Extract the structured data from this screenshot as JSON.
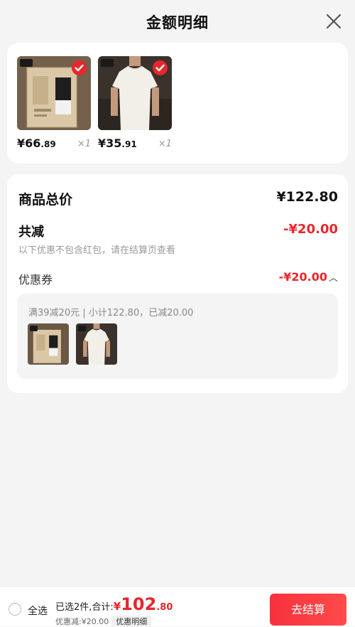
{
  "header": {
    "title": "金额明细"
  },
  "products": [
    {
      "image": "socks-in-box-image",
      "price_yen": "¥66",
      "price_cents": ".89",
      "qty": "×1"
    },
    {
      "image": "white-tshirt-image",
      "price_yen": "¥35",
      "price_cents": ".91",
      "qty": "×1"
    }
  ],
  "summary": {
    "total_label": "商品总价",
    "total_value": "¥122.80",
    "reduce_label": "共减",
    "reduce_value": "-¥20.00",
    "note": "以下优惠不包含红包，请在结算页查看",
    "coupon_label": "优惠券",
    "coupon_value": "-¥20.00",
    "coupon_desc": "满39减20元 | 小计122.80，已减20.00"
  },
  "bottom": {
    "select_all": "全选",
    "selected_prefix": "已选2件,合计:",
    "price_symbol": "¥",
    "price_int": "102",
    "price_dec": ".80",
    "discount_text": "优惠减:¥20.00",
    "detail_label": "优惠明细",
    "checkout_label": "去结算"
  },
  "colors": {
    "accent": "#e8262d",
    "background": "#f4f4f4"
  }
}
